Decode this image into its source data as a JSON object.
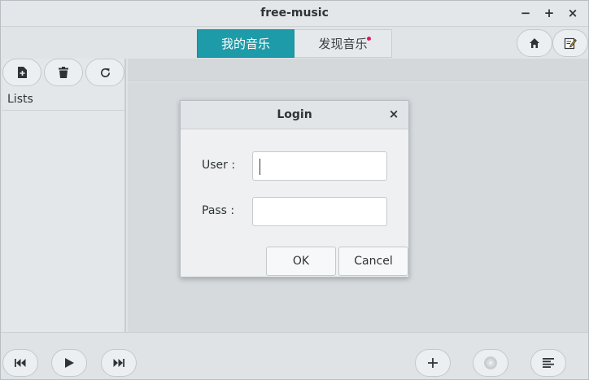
{
  "window": {
    "title": "free-music"
  },
  "wm": {
    "minimize": "−",
    "maximize": "+",
    "close": "×"
  },
  "tabs": [
    {
      "label": "我的音乐",
      "active": true
    },
    {
      "label": "发现音乐",
      "active": false,
      "badge_dot": true
    }
  ],
  "header_icons": [
    "home-icon",
    "edit-icon"
  ],
  "left_panel": {
    "toolbar_icons": [
      "add-file-icon",
      "trash-icon",
      "refresh-icon"
    ],
    "lists_header": "Lists"
  },
  "player": {
    "icons": [
      "previous-icon",
      "play-icon",
      "next-icon",
      "add-icon",
      "disc-icon",
      "playlist-icon"
    ]
  },
  "dialog": {
    "title": "Login",
    "close": "×",
    "user_label": "User :",
    "user_value": "",
    "pass_label": "Pass :",
    "pass_value": "",
    "ok_label": "OK",
    "cancel_label": "Cancel"
  },
  "colors": {
    "accent": "#1e9ba8",
    "badge": "#e01b5a",
    "background": "#dfe3e6"
  }
}
